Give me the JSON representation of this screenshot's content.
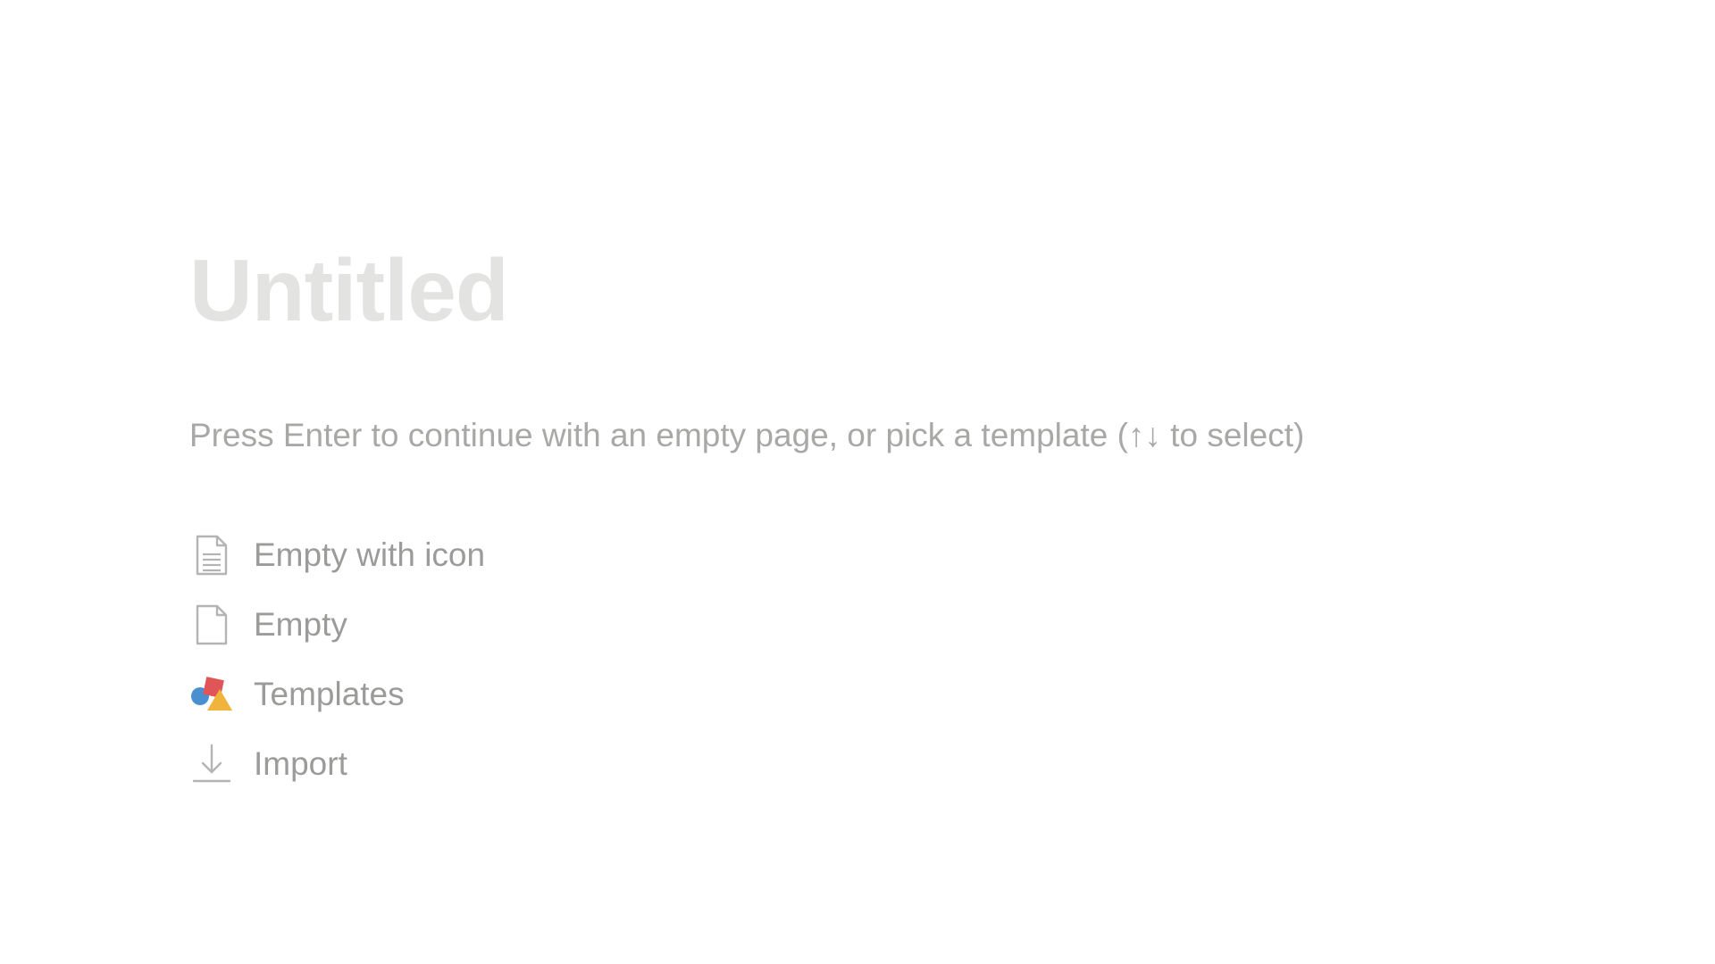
{
  "page": {
    "title_placeholder": "Untitled",
    "hint": "Press Enter to continue with an empty page, or pick a template (↑↓ to select)"
  },
  "options": [
    {
      "label": "Empty with icon",
      "icon": "document-lines-icon"
    },
    {
      "label": "Empty",
      "icon": "blank-document-icon"
    },
    {
      "label": "Templates",
      "icon": "templates-shapes-icon"
    },
    {
      "label": "Import",
      "icon": "download-arrow-icon"
    }
  ],
  "colors": {
    "background": "#ffffff",
    "title_placeholder": "#e3e3e2",
    "hint_text": "#a8a8a6",
    "option_text": "#9b9b99",
    "icon_stroke": "#b4b4b2",
    "templates_blue": "#4a90d0",
    "templates_red": "#e05557",
    "templates_yellow": "#f0b43c"
  }
}
